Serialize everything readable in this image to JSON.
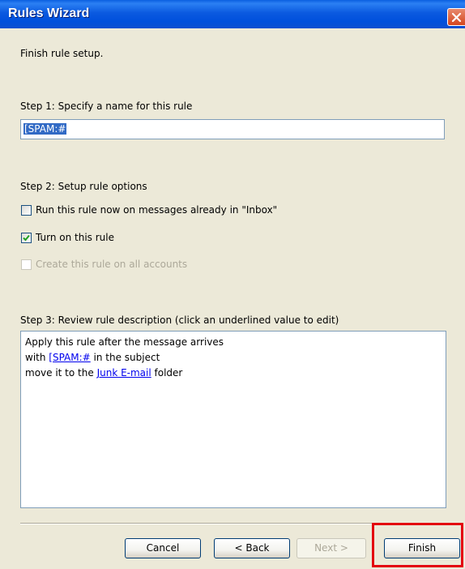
{
  "window": {
    "title": "Rules Wizard",
    "close_icon": "close-icon"
  },
  "heading": "Finish rule setup.",
  "step1": {
    "label": "Step 1: Specify a name for this rule",
    "name_value": "[SPAM:#"
  },
  "step2": {
    "label": "Step 2: Setup rule options",
    "options": [
      {
        "label": "Run this rule now on messages already in \"Inbox\"",
        "checked": false,
        "enabled": true
      },
      {
        "label": "Turn on this rule",
        "checked": true,
        "enabled": true
      },
      {
        "label": "Create this rule on all accounts",
        "checked": false,
        "enabled": false
      }
    ]
  },
  "step3": {
    "label": "Step 3: Review rule description (click an underlined value to edit)",
    "lines": [
      {
        "text": "Apply this rule after the message arrives"
      },
      {
        "prefix": "with ",
        "link": "[SPAM:#",
        "suffix": " in the subject"
      },
      {
        "prefix": "move it to the ",
        "link": "Junk E-mail",
        "suffix": " folder"
      }
    ]
  },
  "buttons": {
    "cancel": "Cancel",
    "back": "< Back",
    "next": "Next >",
    "finish": "Finish"
  },
  "colors": {
    "title_bar": "#0a5fe0",
    "highlight": "#e3000f",
    "link": "#0000ee"
  }
}
